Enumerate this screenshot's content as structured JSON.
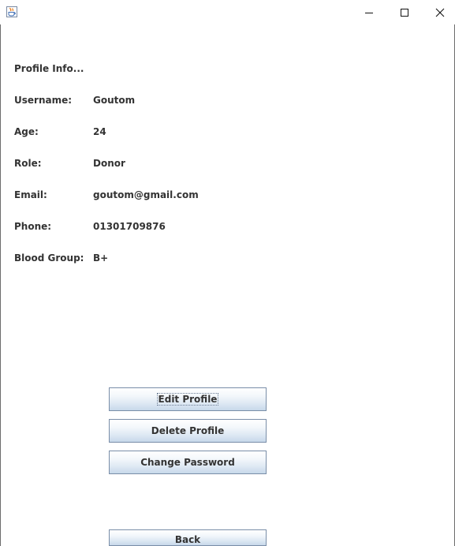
{
  "titlebar": {
    "icon": "java-cup-icon",
    "controls": [
      "minimize-icon",
      "maximize-icon",
      "close-icon"
    ]
  },
  "profile": {
    "heading": "Profile Info...",
    "fields": [
      {
        "label": "Username:",
        "value": "Goutom"
      },
      {
        "label": "Age:",
        "value": "24"
      },
      {
        "label": "Role:",
        "value": "Donor"
      },
      {
        "label": "Email:",
        "value": "goutom@gmail.com"
      },
      {
        "label": "Phone:",
        "value": "01301709876"
      },
      {
        "label": "Blood Group:",
        "value": "B+"
      }
    ]
  },
  "actions": {
    "edit_label": "Edit Profile",
    "delete_label": "Delete Profile",
    "change_password_label": "Change Password",
    "back_label": "Back"
  },
  "colors": {
    "text": "#333333",
    "button_border": "#7a8ea8",
    "button_gradient_bottom": "#c7d8ea"
  }
}
